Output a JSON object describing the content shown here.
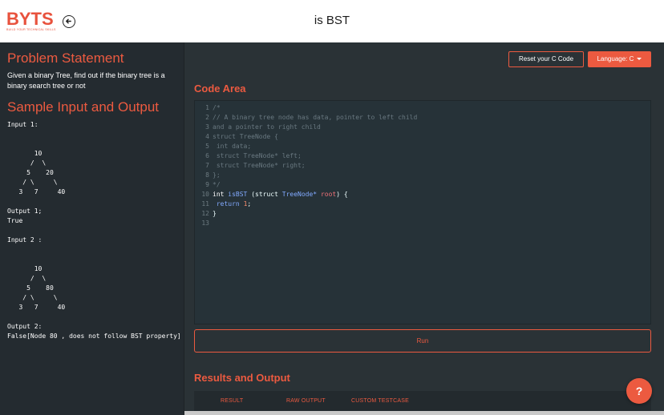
{
  "header": {
    "logo_text": "BYTS",
    "logo_tagline": "BUILD YOUR TECHNICAL SKILLS",
    "title": "is BST"
  },
  "problem": {
    "heading": "Problem Statement",
    "text": "Given a binary Tree, find out if the binary tree is a binary search tree or not"
  },
  "sample": {
    "heading": "Sample Input and Output",
    "content": "Input 1:\n\n\n       10\n      /  \\\n     5    20\n    / \\     \\\n   3   7     40\n\nOutput 1;\nTrue\n\nInput 2 :\n\n\n       10\n      /  \\\n     5    80\n    / \\     \\\n   3   7     40\n\nOutput 2:\nFalse[Node 80 , does not follow BST property]"
  },
  "toolbar": {
    "reset_label": "Reset your C Code",
    "language_label": "Language: C"
  },
  "code_area": {
    "heading": "Code Area",
    "lines": [
      {
        "n": "1",
        "text": "/*"
      },
      {
        "n": "2",
        "text": "// A binary tree node has data, pointer to left child"
      },
      {
        "n": "3",
        "text": "and a pointer to right child"
      },
      {
        "n": "4",
        "text": "struct TreeNode {"
      },
      {
        "n": "5",
        "text": "    int data;"
      },
      {
        "n": "6",
        "text": "    struct TreeNode* left;"
      },
      {
        "n": "7",
        "text": "    struct TreeNode* right;"
      },
      {
        "n": "8",
        "text": "};"
      },
      {
        "n": "9",
        "text": "*/"
      },
      {
        "n": "10",
        "text": "int isBST (struct TreeNode* root) {"
      },
      {
        "n": "11",
        "text": "    return 1;"
      },
      {
        "n": "12",
        "text": "}"
      },
      {
        "n": "13",
        "text": ""
      }
    ]
  },
  "run_label": "Run",
  "results": {
    "heading": "Results and Output",
    "tabs": [
      "RESULT",
      "RAW OUTPUT",
      "CUSTOM TESTCASE"
    ]
  },
  "help_label": "?",
  "colors": {
    "accent": "#ec5a40",
    "panel_dark": "#242b30",
    "editor_bg": "#263238"
  }
}
